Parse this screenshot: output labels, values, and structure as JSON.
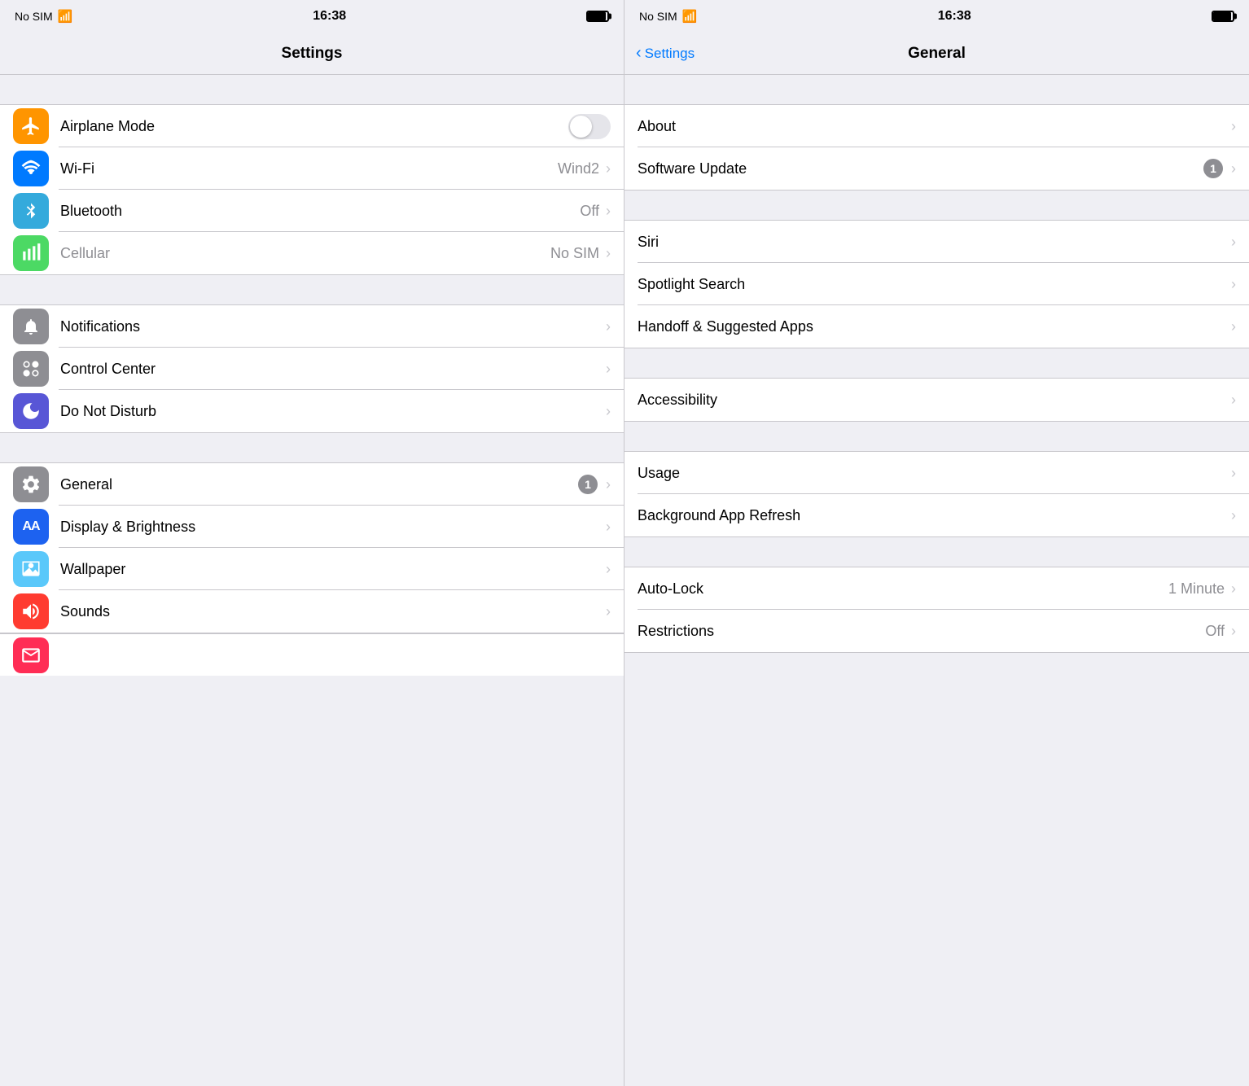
{
  "left_panel": {
    "status": {
      "carrier": "No SIM",
      "wifi": "wifi",
      "time": "16:38"
    },
    "header": {
      "title": "Settings"
    },
    "sections": [
      {
        "id": "connectivity",
        "rows": [
          {
            "id": "airplane",
            "label": "Airplane Mode",
            "icon_color": "icon-orange",
            "icon_char": "✈",
            "has_toggle": true,
            "toggle_on": false
          },
          {
            "id": "wifi",
            "label": "Wi-Fi",
            "icon_color": "icon-blue",
            "icon_char": "wifi",
            "value": "Wind2",
            "has_chevron": true
          },
          {
            "id": "bluetooth",
            "label": "Bluetooth",
            "icon_color": "icon-blue2",
            "icon_char": "bluetooth",
            "value": "Off",
            "has_chevron": true
          },
          {
            "id": "cellular",
            "label": "Cellular",
            "icon_color": "icon-green-light",
            "icon_char": "cellular",
            "value": "No SIM",
            "has_chevron": true,
            "label_gray": true
          }
        ]
      },
      {
        "id": "notifications",
        "rows": [
          {
            "id": "notifications",
            "label": "Notifications",
            "icon_color": "icon-gray",
            "icon_char": "notif",
            "has_chevron": true
          },
          {
            "id": "control-center",
            "label": "Control Center",
            "icon_color": "icon-gray",
            "icon_char": "cc",
            "has_chevron": true
          },
          {
            "id": "do-not-disturb",
            "label": "Do Not Disturb",
            "icon_color": "icon-purple",
            "icon_char": "moon",
            "has_chevron": true
          }
        ]
      },
      {
        "id": "general",
        "rows": [
          {
            "id": "general",
            "label": "General",
            "icon_color": "icon-gray",
            "icon_char": "gear",
            "badge": "1",
            "has_chevron": true
          },
          {
            "id": "display",
            "label": "Display & Brightness",
            "icon_color": "icon-blue3",
            "icon_char": "AA",
            "has_chevron": true
          },
          {
            "id": "wallpaper",
            "label": "Wallpaper",
            "icon_color": "icon-teal",
            "icon_char": "wallpaper",
            "has_chevron": true
          },
          {
            "id": "sounds",
            "label": "Sounds",
            "icon_color": "icon-red",
            "icon_char": "sound",
            "has_chevron": true
          }
        ]
      }
    ]
  },
  "right_panel": {
    "status": {
      "carrier": "No SIM",
      "wifi": "wifi",
      "time": "16:38"
    },
    "nav": {
      "back_label": "Settings",
      "title": "General"
    },
    "sections": [
      {
        "id": "about-section",
        "rows": [
          {
            "id": "about",
            "label": "About",
            "has_chevron": true
          },
          {
            "id": "software-update",
            "label": "Software Update",
            "badge": "1",
            "has_chevron": true
          }
        ]
      },
      {
        "id": "siri-section",
        "rows": [
          {
            "id": "siri",
            "label": "Siri",
            "has_chevron": true
          },
          {
            "id": "spotlight",
            "label": "Spotlight Search",
            "has_chevron": true
          },
          {
            "id": "handoff",
            "label": "Handoff & Suggested Apps",
            "has_chevron": true
          }
        ]
      },
      {
        "id": "accessibility-section",
        "rows": [
          {
            "id": "accessibility",
            "label": "Accessibility",
            "has_chevron": true
          }
        ]
      },
      {
        "id": "usage-section",
        "rows": [
          {
            "id": "usage",
            "label": "Usage",
            "has_chevron": true
          },
          {
            "id": "background-app-refresh",
            "label": "Background App Refresh",
            "has_chevron": true
          }
        ]
      },
      {
        "id": "lock-section",
        "rows": [
          {
            "id": "auto-lock",
            "label": "Auto-Lock",
            "value": "1 Minute",
            "has_chevron": true
          },
          {
            "id": "restrictions",
            "label": "Restrictions",
            "value": "Off",
            "has_chevron": true
          }
        ]
      }
    ]
  }
}
